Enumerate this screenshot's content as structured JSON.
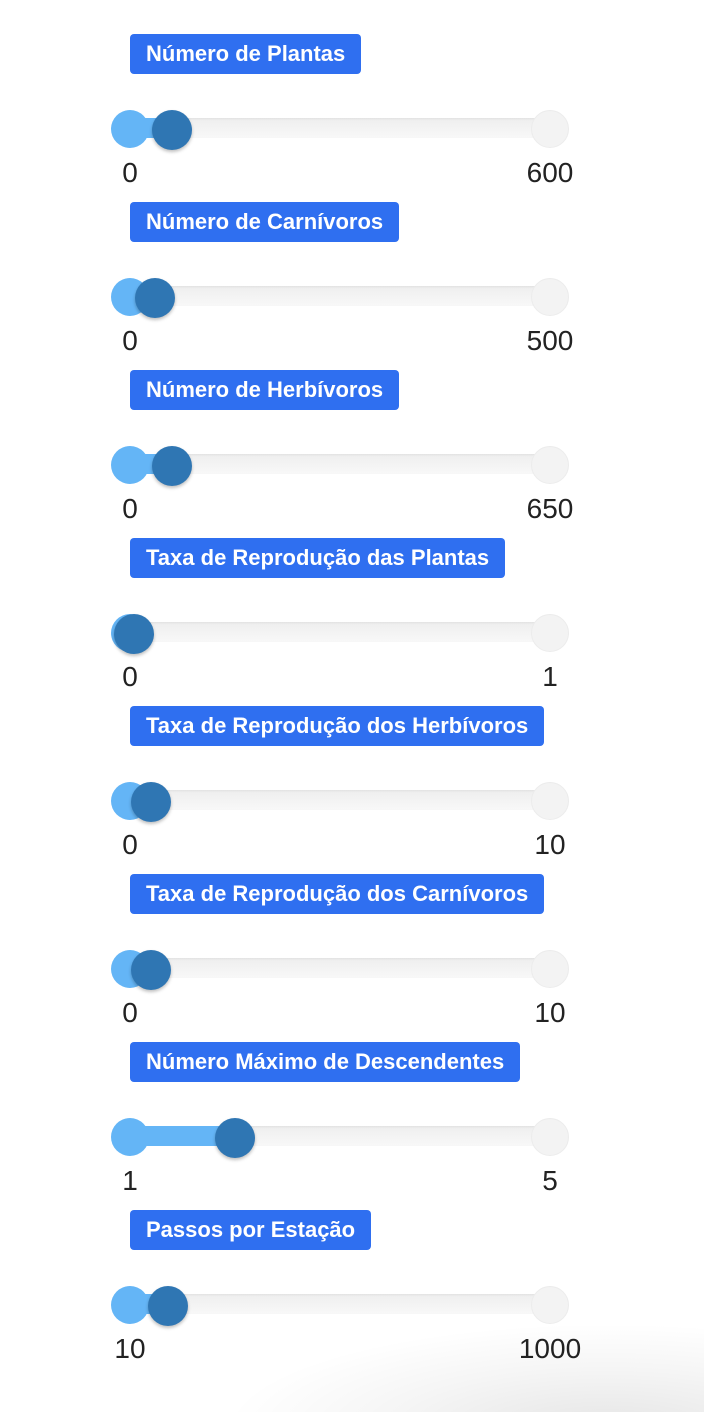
{
  "sliders": [
    {
      "label": "Número de Plantas",
      "min": "0",
      "max": "600",
      "fraction": 0.1
    },
    {
      "label": "Número de Carnívoros",
      "min": "0",
      "max": "500",
      "fraction": 0.06
    },
    {
      "label": "Número de Herbívoros",
      "min": "0",
      "max": "650",
      "fraction": 0.1
    },
    {
      "label": "Taxa de Reprodução das Plantas",
      "min": "0",
      "max": "1",
      "fraction": 0.01
    },
    {
      "label": "Taxa de Reprodução dos Herbívoros",
      "min": "0",
      "max": "10",
      "fraction": 0.05
    },
    {
      "label": "Taxa de Reprodução dos Carnívoros",
      "min": "0",
      "max": "10",
      "fraction": 0.05
    },
    {
      "label": "Número Máximo de Descendentes",
      "min": "1",
      "max": "5",
      "fraction": 0.25
    },
    {
      "label": "Passos por Estação",
      "min": "10",
      "max": "1000",
      "fraction": 0.09
    }
  ],
  "colors": {
    "label_bg": "#2f6ff0",
    "handle": "#2f76b3",
    "fill": "#64b5f6",
    "track": "#f3f3f3"
  }
}
